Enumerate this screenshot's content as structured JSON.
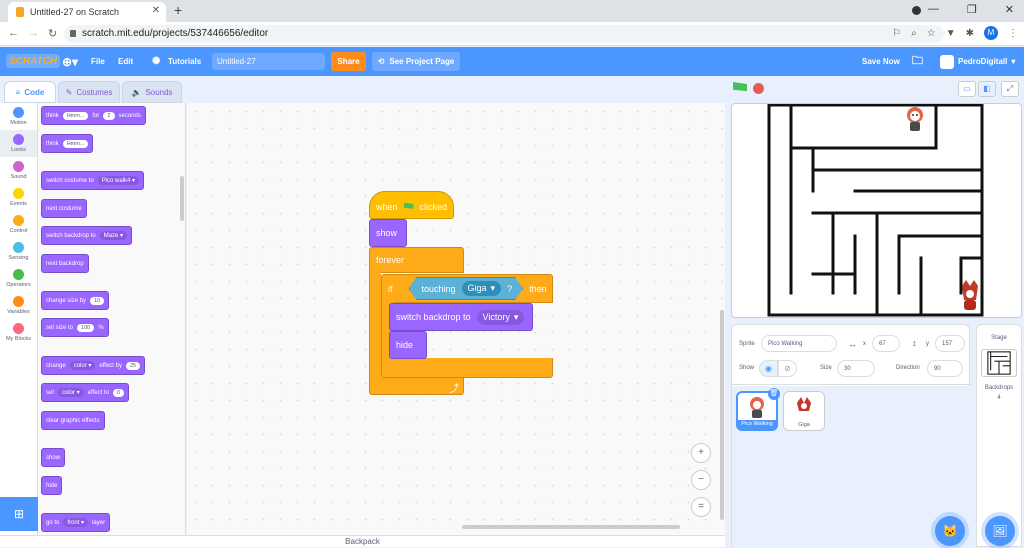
{
  "browser": {
    "tab_title": "Untitled-27 on Scratch",
    "url": "scratch.mit.edu/projects/537446656/editor",
    "profile_initial": "M"
  },
  "menu": {
    "logo": "SCRATCH",
    "file": "File",
    "edit": "Edit",
    "tutorials": "Tutorials",
    "project_title": "Untitled-27",
    "share": "Share",
    "see_project": "See Project Page",
    "save_now": "Save Now",
    "username": "PedroDigitall"
  },
  "tabs": {
    "code": "Code",
    "costumes": "Costumes",
    "sounds": "Sounds"
  },
  "categories": [
    {
      "label": "Motion",
      "color": "#4c97ff"
    },
    {
      "label": "Looks",
      "color": "#9966ff"
    },
    {
      "label": "Sound",
      "color": "#cf63cf"
    },
    {
      "label": "Events",
      "color": "#ffd500"
    },
    {
      "label": "Control",
      "color": "#ffab19"
    },
    {
      "label": "Sensing",
      "color": "#4cbfe6"
    },
    {
      "label": "Operators",
      "color": "#40bf4a"
    },
    {
      "label": "Variables",
      "color": "#ff8c1a"
    },
    {
      "label": "My Blocks",
      "color": "#ff6680"
    }
  ],
  "palette": {
    "think_for": {
      "w1": "think",
      "v1": "Hmm...",
      "w2": "for",
      "v2": "2",
      "w3": "seconds"
    },
    "think": {
      "w1": "think",
      "v1": "Hmm..."
    },
    "switch_costume": {
      "w1": "switch costume to",
      "v1": "Pico walk4"
    },
    "next_costume": "next costume",
    "switch_backdrop": {
      "w1": "switch backdrop to",
      "v1": "Maze"
    },
    "next_backdrop": "next backdrop",
    "change_size": {
      "w1": "change size by",
      "v1": "10"
    },
    "set_size": {
      "w1": "set size to",
      "v1": "100",
      "w2": "%"
    },
    "change_effect": {
      "w1": "change",
      "v1": "color",
      "w2": "effect by",
      "v2": "25"
    },
    "set_effect": {
      "w1": "set",
      "v1": "color",
      "w2": "effect to",
      "v2": "0"
    },
    "clear_effects": "clear graphic effects",
    "show": "show",
    "hide": "hide",
    "go_to": {
      "w1": "go to",
      "v1": "front",
      "w2": "layer"
    }
  },
  "script": {
    "hat": {
      "w1": "when",
      "w2": "clicked"
    },
    "show": "show",
    "forever": "forever",
    "if": "if",
    "then": "then",
    "touching": "touching",
    "touching_target": "Giga",
    "touching_q": "?",
    "switch_backdrop": "switch backdrop to",
    "backdrop_value": "Victory",
    "hide": "hide"
  },
  "zoom": {
    "in": "+",
    "out": "−",
    "reset": "="
  },
  "backpack": "Backpack",
  "sprite_info": {
    "sprite_label": "Sprite",
    "sprite_name": "Pico Walking",
    "x_label": "x",
    "x_value": "67",
    "y_label": "y",
    "y_value": "157",
    "show_label": "Show",
    "size_label": "Size",
    "size_value": "30",
    "direction_label": "Direction",
    "direction_value": "90"
  },
  "sprites": [
    {
      "name": "Pico Walking",
      "selected": true
    },
    {
      "name": "Giga",
      "selected": false
    }
  ],
  "stage_panel": {
    "title": "Stage",
    "backdrops_label": "Backdrops",
    "backdrops_count": "4"
  }
}
